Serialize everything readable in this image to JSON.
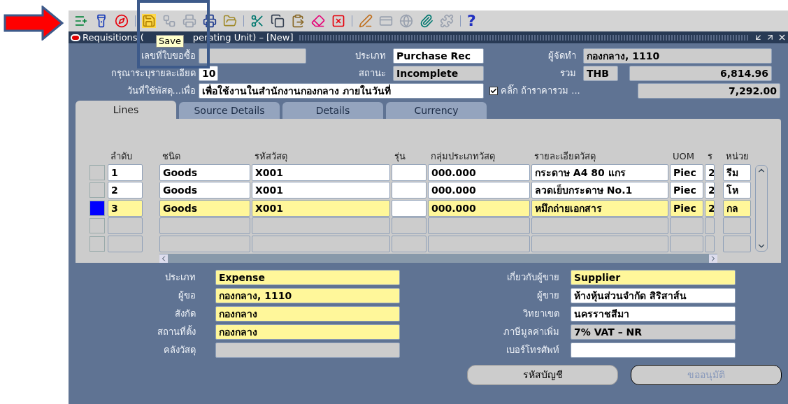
{
  "toolbar": {
    "help": "?"
  },
  "tooltip": "Save",
  "window": {
    "title_before": "Requisitions (",
    "title_after": "perating Unit) – [New]"
  },
  "header_fields": [
    {
      "label": "เลขที่ใบขอซื้อ",
      "kind": "readonly"
    },
    {
      "label": "ประเภท",
      "value": "Purchase Rec",
      "kind": "editable"
    },
    {
      "label": "ผู้จัดทำ",
      "value": "กองกลาง, 1110",
      "kind": "readonly"
    },
    {
      "label": "กรุณาระบุรายละเอียด",
      "value": "10",
      "kind": "editable"
    },
    {
      "label": "สถานะ",
      "value": "Incomplete",
      "kind": "readonly"
    },
    {
      "label": "รวม",
      "value": "THB",
      "kind": "readonly"
    },
    {
      "value": "6,814.96",
      "kind": "readonly"
    },
    {
      "label": "วันที่ใช้พัสดุ...เพื่อ",
      "value": "เพื่อใช้งานในสำนักงานกองกลาง  ภายในวันที่",
      "kind": "editable"
    },
    {
      "value": "7,292.00",
      "kind": "readonly"
    }
  ],
  "checkbox": {
    "label": "คลิ๊ก ถ้าราคารวม ...",
    "checked": true
  },
  "tabs": [
    {
      "label": "Lines",
      "selected": true
    },
    {
      "label": "Source Details",
      "selected": false
    },
    {
      "label": "Details",
      "selected": false
    },
    {
      "label": "Currency",
      "selected": false
    }
  ],
  "table": {
    "columns": [
      "ลำดับ",
      "ชนิด",
      "รหัสวัสดุ",
      "รุ่น",
      "กลุ่มประเภทวัสดุ",
      "รายละเอียดวัสดุ",
      "UOM",
      "ร",
      "หน่วย"
    ],
    "rows": [
      {
        "selected": false,
        "cells": [
          "1",
          "Goods",
          "X001",
          null,
          "000.000",
          "กระดาษ A4  80 แกร",
          "Piec",
          "2",
          "รีม"
        ]
      },
      {
        "selected": false,
        "cells": [
          "2",
          "Goods",
          "X001",
          null,
          "000.000",
          "ลวดเย็บกระดาษ No.1",
          "Piec",
          "2",
          "โห"
        ]
      },
      {
        "selected": true,
        "cells": [
          "3",
          "Goods",
          "X001",
          null,
          "000.000",
          "หมึกถ่ายเอกสาร",
          "Piec",
          "2",
          "กล"
        ]
      }
    ]
  },
  "left_fields": [
    {
      "label": "ประเภท",
      "value": "Expense",
      "kind": "required"
    },
    {
      "label": "ผู้ขอ",
      "value": "กองกลาง, 1110",
      "kind": "required"
    },
    {
      "label": "สังกัด",
      "value": "กองกลาง",
      "kind": "required"
    },
    {
      "label": "สถานที่ตั้ง",
      "value": "กองกลาง",
      "kind": "required"
    },
    {
      "label": "คลังวัสดุ",
      "kind": "readonly"
    }
  ],
  "right_fields": [
    {
      "label": "เกี่ยวกับผู้ขาย",
      "value": "Supplier",
      "kind": "required"
    },
    {
      "label": "ผู้ขาย",
      "value": "ห้างหุ้นส่วนจำกัด สิริสาส์น",
      "kind": "editable"
    },
    {
      "label": "วิทยาเขต",
      "value": "นครราชสีมา",
      "kind": "editable"
    },
    {
      "label": "ภาษีมูลค่าเพิ่ม",
      "value": "7% VAT – NR",
      "kind": "readonly"
    },
    {
      "label": "เบอร์โทรศัพท์",
      "kind": "editable"
    }
  ],
  "buttons": [
    {
      "label": "รหัสบัญชี",
      "disabled": false
    },
    {
      "label": "ขออนุมัติ",
      "disabled": true
    }
  ]
}
